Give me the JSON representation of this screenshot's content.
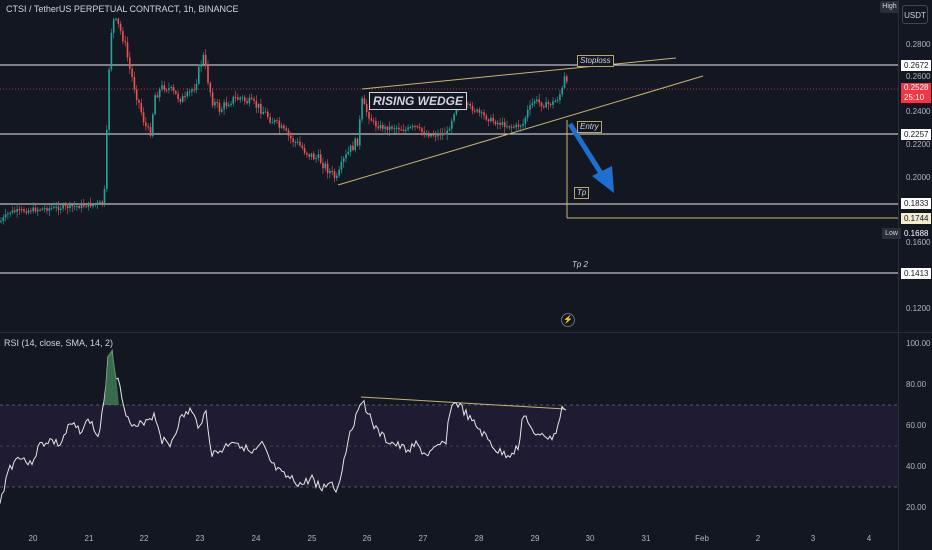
{
  "header": {
    "symbol_title": "CTSI / TetherUS PERPETUAL CONTRACT, 1h, BINANCE",
    "high_button": "High",
    "currency_button": "USDT"
  },
  "price_axis": {
    "ticks": [
      "0.2800",
      "0.2600",
      "0.2400",
      "0.2200",
      "0.2000",
      "0.1600",
      "0.1200"
    ],
    "labels": {
      "stoploss_level": "0.2672",
      "current_price": "0.2528",
      "countdown": "25:10",
      "entry_level": "0.2257",
      "support_level": "0.1833",
      "tp_level": "0.1744",
      "low_value": "0.1688",
      "tp2_level": "0.1413"
    },
    "low_tag": "Low"
  },
  "annotations": {
    "pattern": "RISING WEDGE",
    "stoploss": "Stoploss",
    "entry": "Entry",
    "tp": "Tp",
    "tp2": "Tp 2"
  },
  "rsi": {
    "title": "RSI (14, close, SMA, 14, 2)",
    "ticks": [
      "100.00",
      "80.00",
      "60.00",
      "40.00",
      "20.00"
    ]
  },
  "time_axis": {
    "dates": [
      "20",
      "21",
      "22",
      "23",
      "24",
      "25",
      "26",
      "27",
      "28",
      "29",
      "30",
      "31",
      "Feb",
      "2",
      "3",
      "4"
    ]
  },
  "colors": {
    "background": "#131722",
    "bull": "#26a69a",
    "bear": "#ef5350",
    "wedge_line": "#c8b46e",
    "arrow": "#1e6fd0",
    "rsi_line": "#e6e6e6",
    "current_price": "#f23645"
  }
}
